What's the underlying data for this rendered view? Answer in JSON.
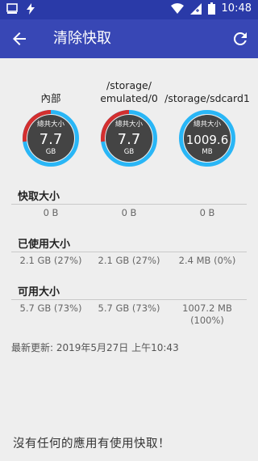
{
  "statusbar": {
    "time": "10:48"
  },
  "appbar": {
    "title": "清除快取"
  },
  "gauges": [
    {
      "label": "內部",
      "ring_label": "總共大小",
      "value": "7.7",
      "unit": "GB",
      "fill_fraction": 0.27,
      "fill_color": "#d32f2f"
    },
    {
      "label": "/storage/\nemulated/0",
      "ring_label": "總共大小",
      "value": "7.7",
      "unit": "GB",
      "fill_fraction": 0.27,
      "fill_color": "#d32f2f"
    },
    {
      "label": "/storage/sdcard1",
      "ring_label": "總共大小",
      "value": "1009.6",
      "unit": "MB",
      "fill_fraction": 0.0,
      "fill_color": "#d32f2f"
    }
  ],
  "colors": {
    "ring": "#29b6f6",
    "gauge_bg": "#444444",
    "accent": "#3847b5"
  },
  "sections": {
    "cache": {
      "title": "快取大小",
      "values": [
        "0 B",
        "0 B",
        "0 B"
      ]
    },
    "used": {
      "title": "已使用大小",
      "values": [
        "2.1 GB (27%)",
        "2.1 GB (27%)",
        "2.4 MB (0%)"
      ]
    },
    "free": {
      "title": "可用大小",
      "values": [
        "5.7 GB (73%)",
        "5.7 GB (73%)",
        "1007.2 MB\n(100%)"
      ]
    }
  },
  "updated": "最新更新: 2019年5月27日 上午10:43",
  "empty_message": "沒有任何的應用有使用快取！"
}
